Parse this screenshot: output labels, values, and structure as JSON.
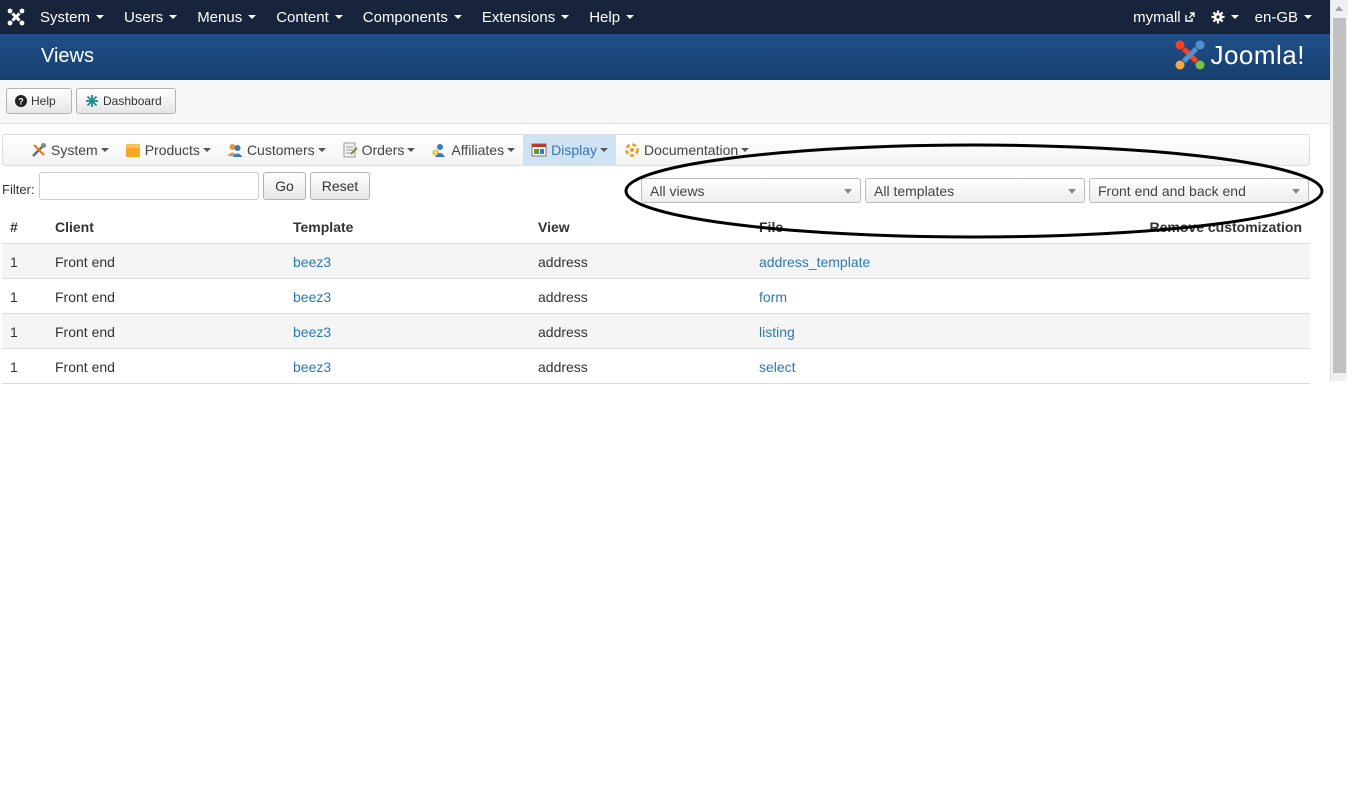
{
  "topbar": {
    "logo_icon": "joomla-icon",
    "menu": [
      {
        "label": "System"
      },
      {
        "label": "Users"
      },
      {
        "label": "Menus"
      },
      {
        "label": "Content"
      },
      {
        "label": "Components"
      },
      {
        "label": "Extensions"
      },
      {
        "label": "Help"
      }
    ],
    "site_name": "mymall",
    "language": "en-GB"
  },
  "header": {
    "page_title": "Views",
    "brand": "Joomla!"
  },
  "toolbar": {
    "help_label": "Help",
    "dashboard_label": "Dashboard"
  },
  "component_menu": [
    {
      "label": "System",
      "icon": "tools-icon"
    },
    {
      "label": "Products",
      "icon": "products-icon"
    },
    {
      "label": "Customers",
      "icon": "customers-icon"
    },
    {
      "label": "Orders",
      "icon": "orders-icon"
    },
    {
      "label": "Affiliates",
      "icon": "affiliates-icon"
    },
    {
      "label": "Display",
      "icon": "display-icon",
      "active": true
    },
    {
      "label": "Documentation",
      "icon": "documentation-icon"
    }
  ],
  "filter": {
    "label": "Filter:",
    "value": "",
    "go_label": "Go",
    "reset_label": "Reset"
  },
  "selects": {
    "views": "All views",
    "templates": "All templates",
    "client": "Front end and back end"
  },
  "table": {
    "headers": {
      "num": "#",
      "client": "Client",
      "template": "Template",
      "view": "View",
      "file": "File",
      "remove": "Remove customization"
    },
    "rows": [
      {
        "num": "1",
        "client": "Front end",
        "template": "beez3",
        "view": "address",
        "file": "address_template"
      },
      {
        "num": "1",
        "client": "Front end",
        "template": "beez3",
        "view": "address",
        "file": "form"
      },
      {
        "num": "1",
        "client": "Front end",
        "template": "beez3",
        "view": "address",
        "file": "listing"
      },
      {
        "num": "1",
        "client": "Front end",
        "template": "beez3",
        "view": "address",
        "file": "select"
      }
    ]
  },
  "colors": {
    "topbar_bg": "#17243c",
    "header_bg": "#1f5089",
    "link": "#2a7ab0",
    "active_menu_bg": "#cfe3f5"
  }
}
